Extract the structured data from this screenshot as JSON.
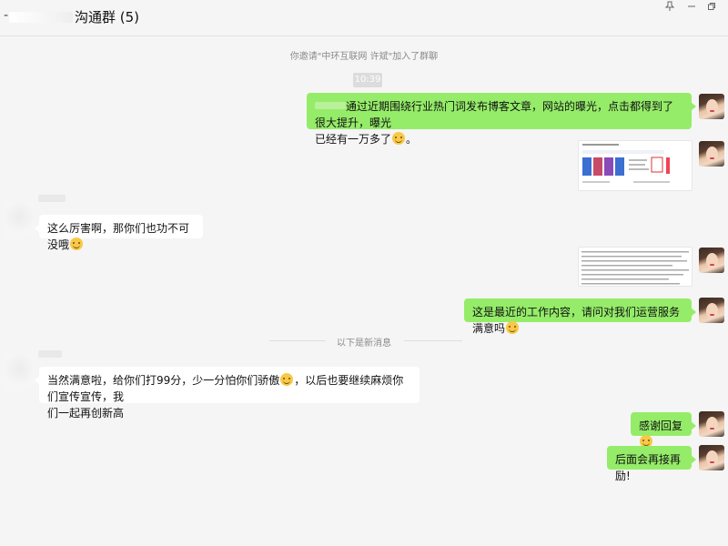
{
  "window": {
    "title": "沟通群 (5)",
    "dash": "-"
  },
  "system": {
    "invite_text": "你邀请\"中环互联网 许斌\"加入了群聊",
    "time": "10:39",
    "new_divider": "以下是新消息"
  },
  "messages": [
    {
      "side": "me",
      "text_a": "通过近期围绕行业热门词发布博客文章，网站的曝光，点击都得到了很大提升，曝光",
      "text_b": "已经有一万多了",
      "text_c": "。",
      "emoji": "smile-emoji"
    },
    {
      "side": "me",
      "type": "image",
      "image": "search-results-screenshot"
    },
    {
      "side": "other",
      "text": "这么厉害啊，那你们也功不可没哦",
      "emoji": "smile-emoji"
    },
    {
      "side": "me",
      "type": "image",
      "image": "document-screenshot"
    },
    {
      "side": "me",
      "text": "这是最近的工作内容，请问对我们运营服务满意吗",
      "emoji": "smile-emoji"
    },
    {
      "side": "other",
      "text_a": "当然满意啦，给你们打99分，少一分怕你们骄傲",
      "text_b": "，以后也要继续麻烦你们宣传宣传，我",
      "text_c": "们一起再创新高",
      "emoji": "smile-emoji"
    },
    {
      "side": "me",
      "text": "感谢回复",
      "emoji": "smile-emoji"
    },
    {
      "side": "me",
      "text": "后面会再接再励!"
    }
  ],
  "colors": {
    "my_bubble": "#95ec69",
    "other_bubble": "#ffffff",
    "background": "#f5f5f5"
  }
}
